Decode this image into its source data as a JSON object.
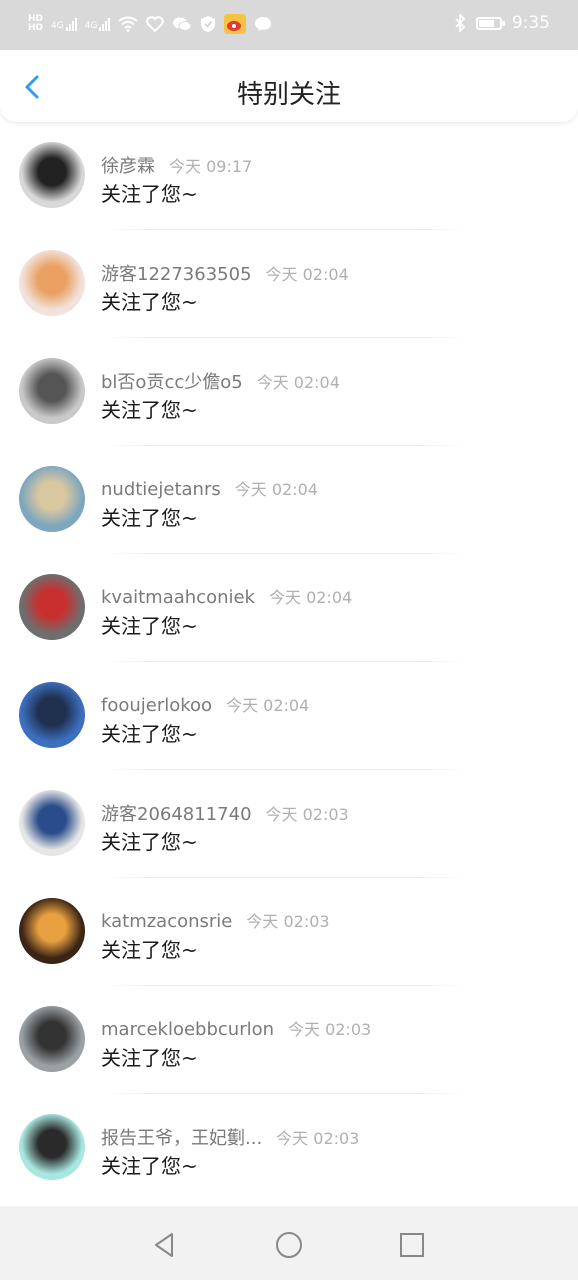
{
  "status_bar": {
    "left_text_1": "HD",
    "left_text_2": "4G",
    "left_text_3": "4G",
    "time": "9:35",
    "icons": [
      "hd-icon",
      "signal-icon",
      "signal-icon",
      "wifi-icon",
      "heart-icon",
      "wechat-icon",
      "shield-icon",
      "weibo-icon",
      "chat-bubble-icon",
      "bluetooth-icon",
      "battery-icon"
    ]
  },
  "header": {
    "title": "特别关注",
    "back_icon": "chevron-left-icon",
    "accent_color": "#2a9df4"
  },
  "notifications": [
    {
      "name": "徐彦霖",
      "time": "今天 09:17",
      "message": "关注了您~",
      "avatar_colors": [
        "#d8d8d8",
        "#222222"
      ]
    },
    {
      "name": "游客1227363505",
      "time": "今天 02:04",
      "message": "关注了您~",
      "avatar_colors": [
        "#f1e2dc",
        "#e9a060"
      ]
    },
    {
      "name": "bl否o贡cc少儋o5",
      "time": "今天 02:04",
      "message": "关注了您~",
      "avatar_colors": [
        "#c9c9c9",
        "#555555"
      ]
    },
    {
      "name": "nudtiejetanrs",
      "time": "今天 02:04",
      "message": "关注了您~",
      "avatar_colors": [
        "#7fa6bf",
        "#d9c7a0"
      ]
    },
    {
      "name": "kvaitmaahconiek",
      "time": "今天 02:04",
      "message": "关注了您~",
      "avatar_colors": [
        "#6e6e6e",
        "#c83030"
      ]
    },
    {
      "name": "fooujerlokoo",
      "time": "今天 02:04",
      "message": "关注了您~",
      "avatar_colors": [
        "#3c6fbf",
        "#20304f"
      ]
    },
    {
      "name": "游客2064811740",
      "time": "今天 02:03",
      "message": "关注了您~",
      "avatar_colors": [
        "#e6e6e6",
        "#2a4c8a"
      ]
    },
    {
      "name": "katmzaconsrie",
      "time": "今天 02:03",
      "message": "关注了您~",
      "avatar_colors": [
        "#3a2416",
        "#e8a040"
      ]
    },
    {
      "name": "marcekloebbcurlon",
      "time": "今天 02:03",
      "message": "关注了您~",
      "avatar_colors": [
        "#9aa0a4",
        "#333333"
      ]
    },
    {
      "name": "报告王爷，王妃劐...",
      "time": "今天 02:03",
      "message": "关注了您~",
      "avatar_colors": [
        "#a8e6e0",
        "#2a2a2a"
      ]
    }
  ],
  "nav_bar": {
    "icons": [
      "back-triangle-icon",
      "home-circle-icon",
      "recents-square-icon"
    ]
  }
}
